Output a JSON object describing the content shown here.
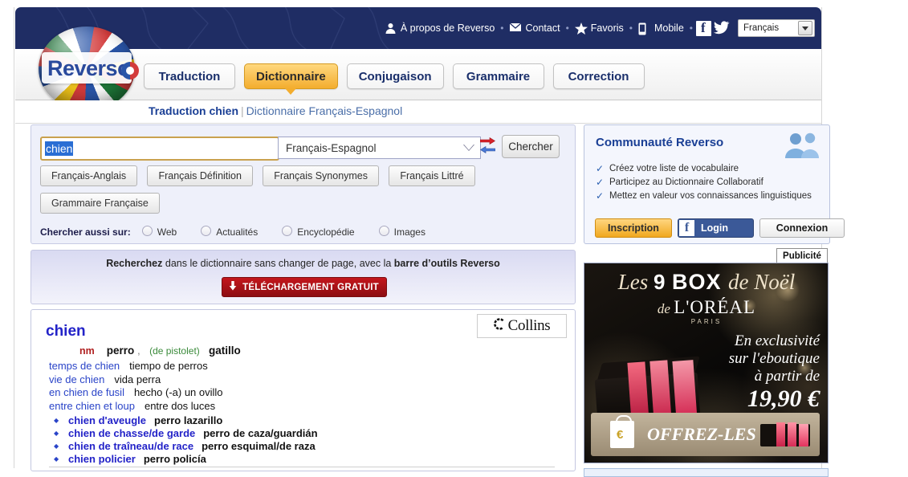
{
  "topbar": {
    "links": [
      {
        "label": "À propos de Reverso",
        "icon": "person-icon"
      },
      {
        "label": "Contact",
        "icon": "envelope-icon"
      },
      {
        "label": "Favoris",
        "icon": "star-icon"
      },
      {
        "label": "Mobile",
        "icon": "phone-icon"
      }
    ],
    "separator": "•",
    "facebook_icon": "facebook-icon",
    "twitter_icon": "twitter-icon",
    "language_selector": "Français"
  },
  "logo": {
    "text": "Reverso"
  },
  "nav": {
    "tabs": [
      {
        "label": "Traduction",
        "active": false
      },
      {
        "label": "Dictionnaire",
        "active": true
      },
      {
        "label": "Conjugaison",
        "active": false
      },
      {
        "label": "Grammaire",
        "active": false
      },
      {
        "label": "Correction",
        "active": false
      }
    ]
  },
  "breadcrumb": {
    "main": "Traduction chien",
    "separator": "|",
    "dictionary": "Dictionnaire Français-Espagnol"
  },
  "search": {
    "query": "chien",
    "placeholder": "",
    "language_pair": "Français-Espagnol",
    "swap_icon": "swap-arrows-icon",
    "button_label": "Chercher",
    "filter_buttons": [
      "Français-Anglais",
      "Français Définition",
      "Français Synonymes",
      "Français Littré",
      "Grammaire Française"
    ],
    "also_search_label": "Chercher aussi sur:",
    "also_search_options": [
      "Web",
      "Actualités",
      "Encyclopédie",
      "Images"
    ]
  },
  "community": {
    "title": "Communauté Reverso",
    "icon": "people-icon",
    "bullets": [
      "Créez votre liste de vocabulaire",
      "Participez au Dictionnaire Collaboratif",
      "Mettez en valeur vos connaissances linguistiques"
    ],
    "btn_signup": "Inscription",
    "btn_facebook": "Login",
    "btn_login": "Connexion"
  },
  "promo": {
    "text_before": "Recherchez",
    "text_middle": " dans le dictionnaire sans changer de page, avec la ",
    "text_bold_end": "barre d’outils Reverso",
    "download_label": "TÉLÉCHARGEMENT GRATUIT",
    "download_icon": "download-arrow-icon"
  },
  "results": {
    "collins_label": "Collins",
    "headword": "chien",
    "pos": "nm",
    "translation_1": "perro",
    "comma": ",",
    "gloss": "(de pistolet)",
    "translation_2": "gatillo",
    "examples": [
      {
        "fr": "temps de chien",
        "es": "tiempo de perros"
      },
      {
        "fr": "vie de chien",
        "es": "vida perra"
      },
      {
        "fr": "en chien de fusil",
        "es": "hecho (-a)   un ovillo"
      },
      {
        "fr": "entre chien et loup",
        "es": "entre dos luces"
      }
    ],
    "compounds": [
      {
        "fr": "chien d'aveugle",
        "es": "perro lazarillo"
      },
      {
        "fr": "chien de chasse/de garde",
        "es": "perro de caza/guardián"
      },
      {
        "fr": "chien de traîneau/de race",
        "es": "perro esquimal/de raza"
      },
      {
        "fr": "chien policier",
        "es": "perro policía"
      }
    ]
  },
  "ad": {
    "label": "Publicité",
    "line1_a": "Les ",
    "line1_b": "9",
    "line1_c": " BOX ",
    "line1_d": "de Noël",
    "line2_de": "de ",
    "line2_brand": "L'ORÉAL",
    "line2_paris": "PARIS",
    "right_1": "En exclusivité",
    "right_2": "sur l'eboutique",
    "right_3": "à partir de",
    "right_4": "19,90 €",
    "cta": "OFFREZ-LES !",
    "cta_icon": "shopping-bag-icon"
  }
}
